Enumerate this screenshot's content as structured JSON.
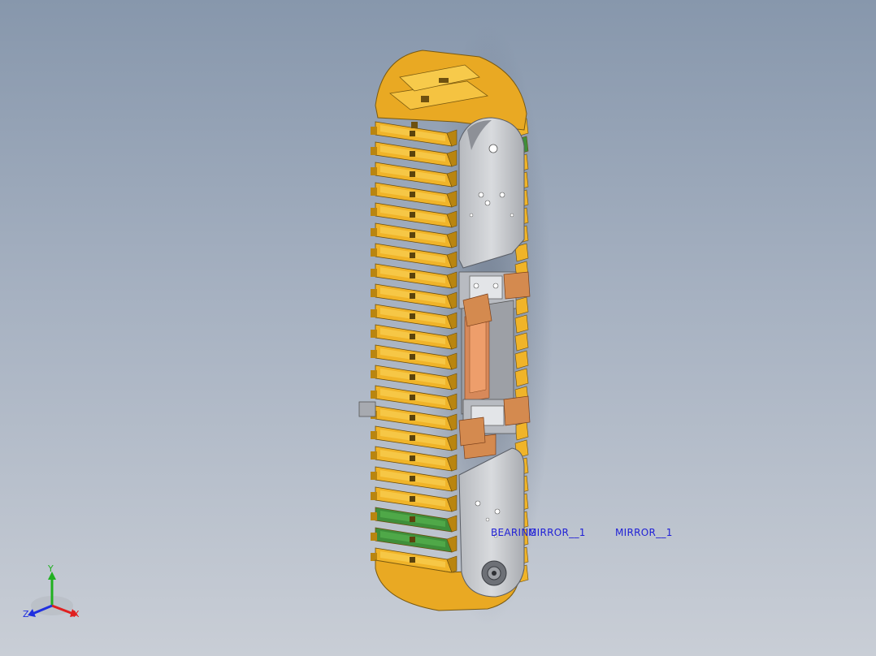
{
  "viewport": {
    "annotations": [
      "BEARING",
      "MIRROR__1",
      "MIRROR__1"
    ]
  },
  "triad": {
    "x_label": "X",
    "y_label": "Y",
    "z_label": "Z"
  },
  "colors": {
    "background_top": "#8797ac",
    "background_bottom": "#c9ced6",
    "chain_link": "#f0b429",
    "chain_link_dark": "#b98510",
    "green_link": "#3f8f3a",
    "plate": "#c9cbcf",
    "copper": "#d48a4f",
    "annotation": "#1f1fd6",
    "x_axis": "#e02020",
    "y_axis": "#20b020",
    "z_axis": "#2030e0"
  }
}
